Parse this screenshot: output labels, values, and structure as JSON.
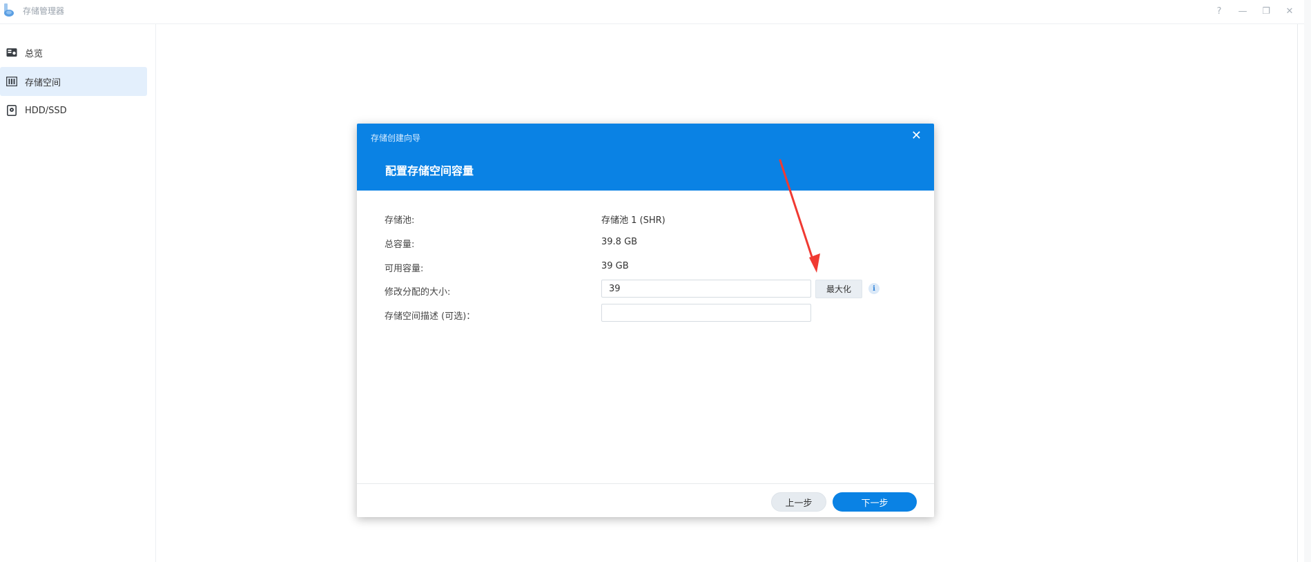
{
  "window": {
    "title": "存储管理器",
    "controls": {
      "help": "?",
      "minimize": "—",
      "restore": "❐",
      "close": "✕"
    }
  },
  "sidebar": {
    "items": [
      {
        "label": "总览",
        "icon": "overview-icon",
        "active": false
      },
      {
        "label": "存储空间",
        "icon": "storage-volume-icon",
        "active": true
      },
      {
        "label": "HDD/SSD",
        "icon": "disk-icon",
        "active": false
      }
    ]
  },
  "modal": {
    "wizard_title": "存储创建向导",
    "close": "✕",
    "step_title": "配置存储空间容量",
    "fields": {
      "pool_label": "存储池:",
      "pool_value": "存储池 1 (SHR)",
      "total_label": "总容量:",
      "total_value": "39.8 GB",
      "available_label": "可用容量:",
      "available_value": "39 GB",
      "size_label": "修改分配的大小:",
      "size_value": "39",
      "maximize_label": "最大化",
      "info": "i",
      "desc_label": "存储空间描述 (可选)：",
      "desc_value": ""
    },
    "footer": {
      "prev_label": "上一步",
      "next_label": "下一步"
    }
  },
  "colors": {
    "accent": "#0a82e4",
    "active_nav": "#e3effc",
    "annotation_arrow": "#f03a32"
  }
}
